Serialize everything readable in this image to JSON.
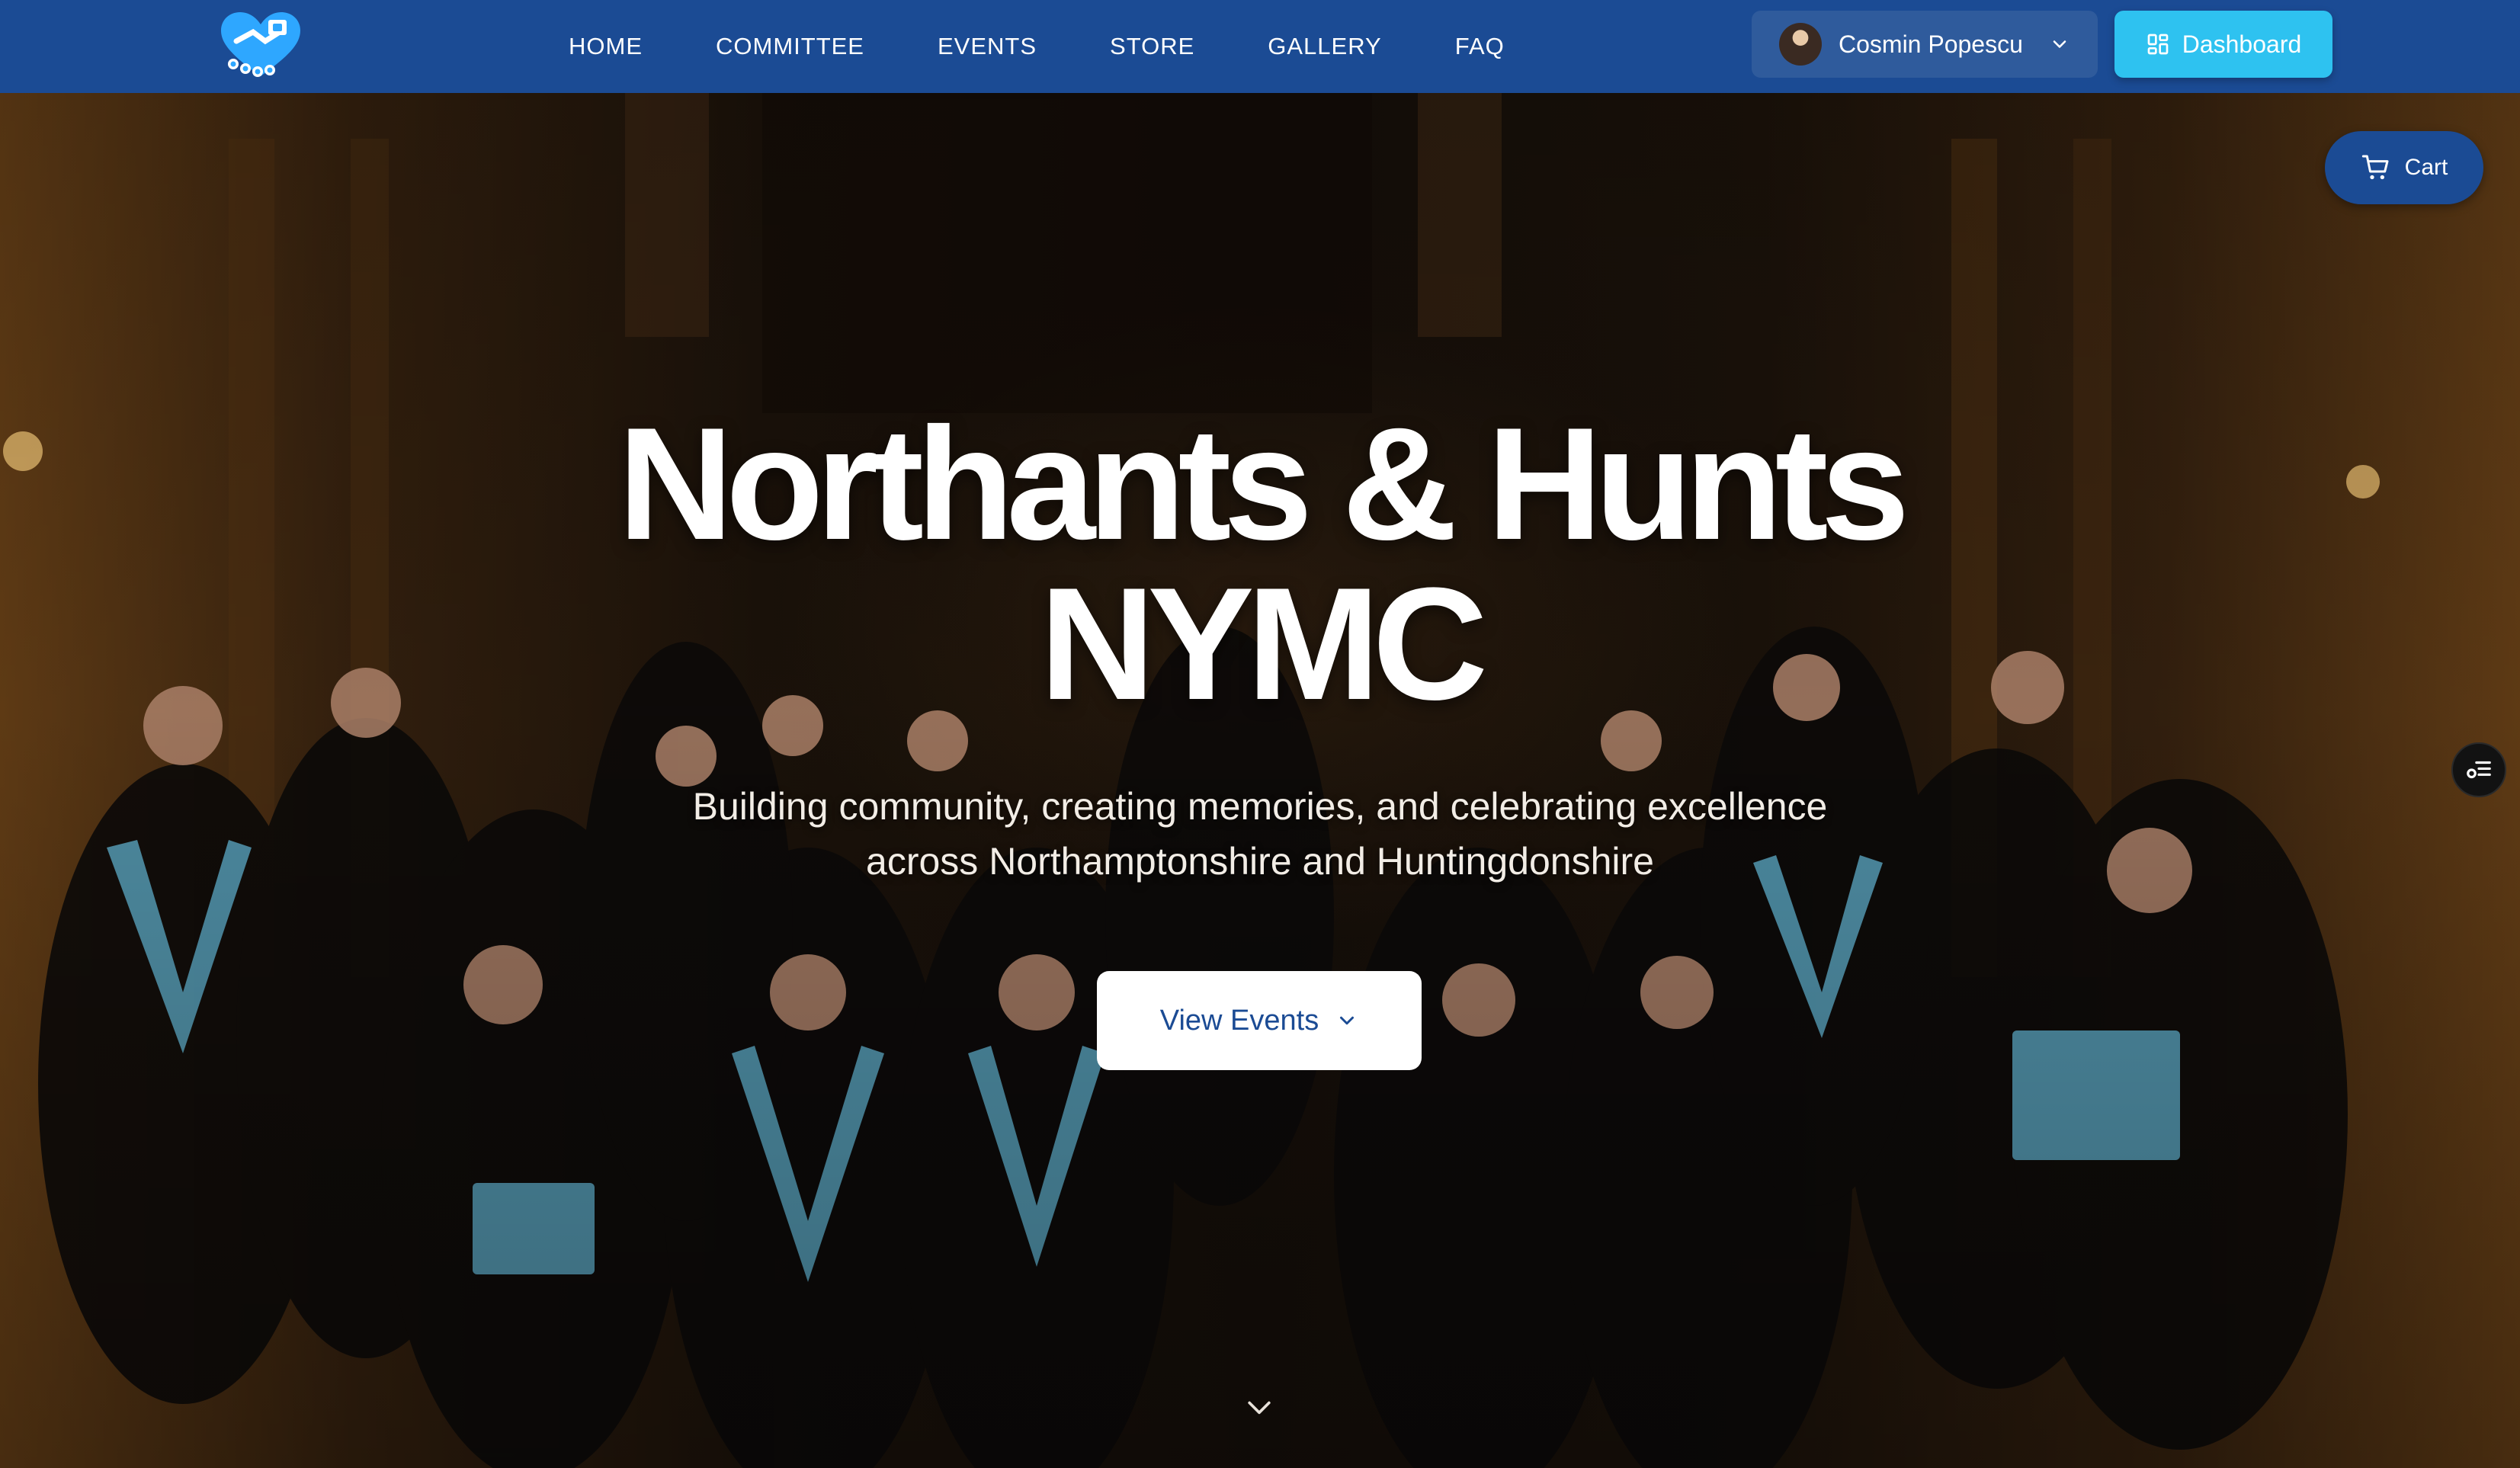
{
  "nav": {
    "logo_icon": "handshake-heart-logo-icon",
    "links": [
      "HOME",
      "COMMITTEE",
      "EVENTS",
      "STORE",
      "GALLERY",
      "FAQ"
    ],
    "user": {
      "name": "Cosmin Popescu",
      "icon": "chevron-down-icon"
    },
    "dashboard": {
      "label": "Dashboard",
      "icon": "dashboard-grid-icon"
    }
  },
  "hero": {
    "title_line1": "Northants & Hunts",
    "title_line2": "NYMC",
    "subtitle": "Building community, creating memories, and celebrating excellence across Northamptonshire and Huntingdonshire",
    "cta": {
      "label": "View Events",
      "icon": "chevron-down-icon"
    },
    "background_image": "group-photo-masonic-lodge"
  },
  "cart": {
    "label": "Cart",
    "icon": "shopping-cart-icon"
  },
  "floating": {
    "icon": "settings-list-icon"
  },
  "scroll_indicator": {
    "icon": "chevron-down-icon"
  },
  "colors": {
    "navbar": "#1b4b94",
    "dashboard_button": "#2ec2f0",
    "user_button": "#2f5b9c",
    "cta_text": "#1b4b94"
  }
}
